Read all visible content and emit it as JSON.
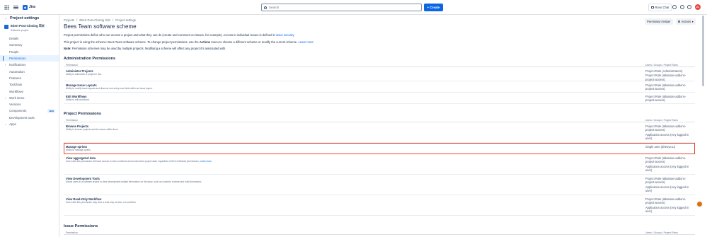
{
  "topbar": {
    "app_name": "Jira",
    "search_placeholder": "Search",
    "create_label": "+ Create",
    "rovo_label": "Rovo Chat",
    "avatar_initials": "ZL"
  },
  "sidebar": {
    "header": "Project settings",
    "project_name": "Ebert Post-Closing 회보",
    "project_type": "Software project",
    "items": [
      {
        "label": "Details",
        "active": false
      },
      {
        "label": "Summary",
        "active": false
      },
      {
        "label": "People",
        "active": false
      },
      {
        "label": "Permissions",
        "active": true
      },
      {
        "label": "Notifications",
        "active": false,
        "expandable": true
      },
      {
        "label": "Automation",
        "active": false
      },
      {
        "label": "Features",
        "active": false
      },
      {
        "label": "Toolchain",
        "active": false
      },
      {
        "label": "Workflows",
        "active": false
      },
      {
        "label": "Work items",
        "active": false,
        "expandable": true
      },
      {
        "label": "Versions",
        "active": false
      },
      {
        "label": "Components",
        "active": false,
        "badge": "NEW"
      },
      {
        "label": "Development tools",
        "active": false
      },
      {
        "label": "Apps",
        "active": false,
        "expandable": true
      }
    ]
  },
  "breadcrumb": [
    "Projects",
    "Ebert Post-Closing 회보",
    "Project settings"
  ],
  "page_title": "Bees Team software scheme",
  "buttons": {
    "helper": "Permission helper",
    "actions": "Actions"
  },
  "description": {
    "line1": "Project permissions define who can access a project and what they can do (create and comment on issues, for example). Access to individual issues is defined in",
    "line1_link": "issue security.",
    "line2_pre": "This project is using the scheme: Bees Team software scheme. To change project permissions, use the",
    "line2_bold": "Actions",
    "line2_post": "menu to choose a different scheme or modify the current scheme.",
    "line2_link": "Learn more",
    "note_label": "Note:",
    "note_text": "Permission schemes may be used by multiple projects. Modifying a scheme will affect any project it's associated with."
  },
  "table_headers": {
    "permission": "Permission",
    "holders": "Users / Groups / Project Roles"
  },
  "sections": [
    {
      "title": "Administration Permissions",
      "rows": [
        {
          "name": "Administer Projects",
          "desc": "Ability to administer a project in Jira.",
          "holders": [
            "Project Role (Administrators)",
            "Project Role (atlassian-addons-project-access)"
          ]
        },
        {
          "name": "Manage Issue Layouts",
          "desc": "Ability to modify issue layouts and discover and setup new fields within an issue layout.",
          "holders": [
            "Project Role (atlassian-addons-project-access)"
          ]
        },
        {
          "name": "Edit Workflows",
          "desc": "Ability to edit workflows.",
          "holders": [
            "Project Role (atlassian-addons-project-access)"
          ]
        }
      ]
    },
    {
      "title": "Project Permissions",
      "rows": [
        {
          "name": "Browse Projects",
          "desc": "Ability to browse projects and the issues within them.",
          "holders": [
            "Project Role (atlassian-addons-project-access)",
            "Application access (Any logged in user)"
          ]
        },
        {
          "name": "Manage sprints",
          "desc": "Ability to manage sprints.",
          "holders": [
            "Single user (Zhenya Li)"
          ],
          "highlight": true
        },
        {
          "name": "View aggregated data",
          "desc": "Users with this permission will have access to view combined and summarized project data, regardless of their individual permissions.",
          "desc_link": "Learn more",
          "holders": [
            "Project Role (atlassian-addons-project-access)",
            "Application access (Any logged in user)"
          ]
        },
        {
          "name": "View Development Tools",
          "desc": "Allows users in a software project to view development-related information on the issue, such as commits, reviews and build information.",
          "holders": [
            "Project Role (atlassian-addons-project-access)",
            "Application access (Any logged in user)"
          ]
        },
        {
          "name": "View Read-Only Workflow",
          "desc": "Users with this permission may view a read-only version of a workflow.",
          "holders": [
            "Project Role (atlassian-addons-project-access)",
            "Application access (Any logged in user)"
          ]
        }
      ]
    },
    {
      "title": "Issue Permissions",
      "rows": []
    }
  ]
}
